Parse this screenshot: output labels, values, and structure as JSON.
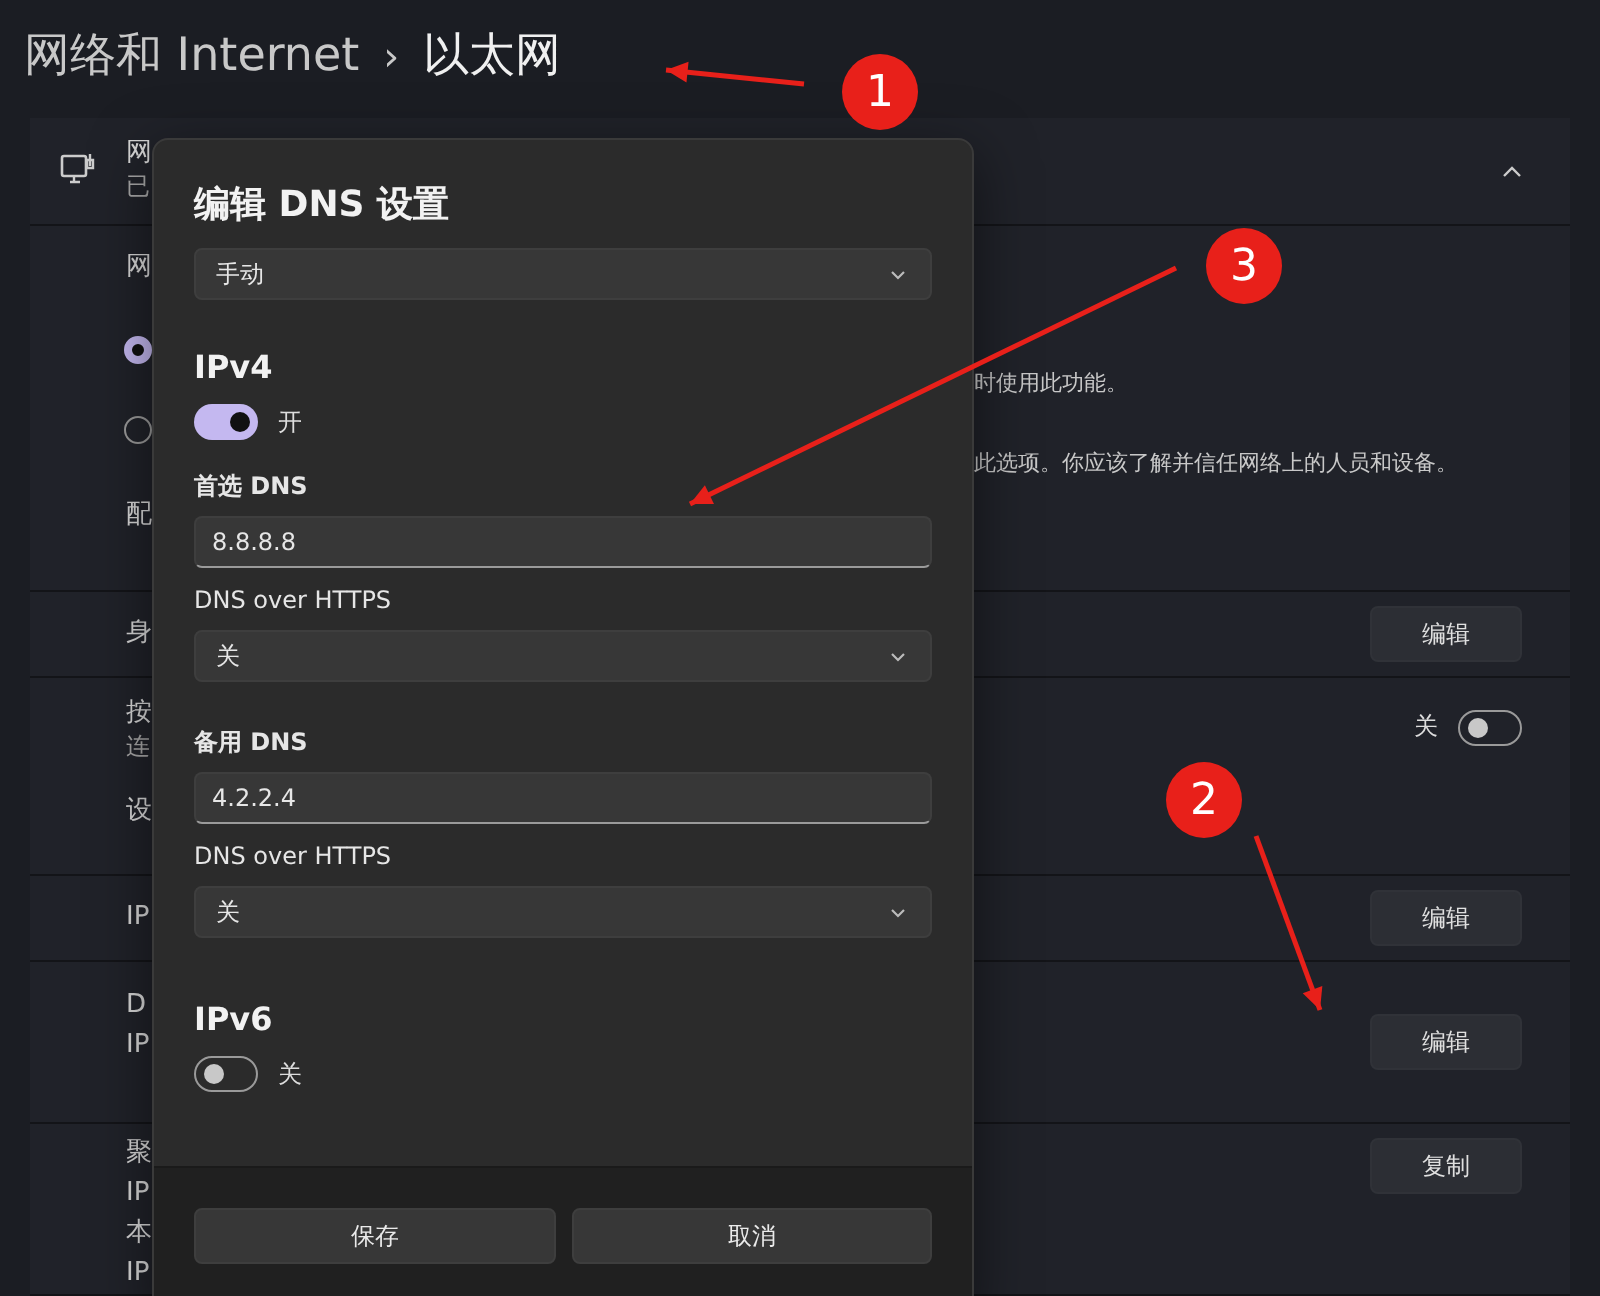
{
  "breadcrumb": {
    "parent": "网络和 Internet",
    "separator": "›",
    "current": "以太网"
  },
  "rows": [
    {
      "kind": "header",
      "fragments": [
        "网",
        "已"
      ],
      "expanded": true
    },
    {
      "kind": "options",
      "fragments": [
        "网"
      ],
      "options": [
        {
          "selected": true,
          "tail": "时使用此功能。"
        },
        {
          "selected": false,
          "tail": "此选项。你应该了解并信任网络上的人员和设备。"
        }
      ],
      "footer_fragment": "配"
    },
    {
      "kind": "button",
      "fragments": [
        "身"
      ],
      "button": "编辑"
    },
    {
      "kind": "toggle",
      "fragments": [
        "按",
        "连"
      ],
      "extra": "设",
      "toggle": {
        "label": "关",
        "on": false
      }
    },
    {
      "kind": "button",
      "fragments": [
        "IP"
      ],
      "button": "编辑"
    },
    {
      "kind": "button",
      "fragments": [
        "D",
        "IP"
      ],
      "button": "编辑"
    },
    {
      "kind": "button",
      "fragments": [
        "聚",
        "IP",
        "本",
        "IP"
      ],
      "button": "复制"
    }
  ],
  "dialog": {
    "title": "编辑 DNS 设置",
    "mode": "手动",
    "ipv4": {
      "heading": "IPv4",
      "on": true,
      "state": "开",
      "fields": [
        {
          "label": "首选 DNS",
          "value": "8.8.8.8",
          "doh_label": "DNS over HTTPS",
          "doh": "关"
        },
        {
          "label": "备用 DNS",
          "value": "4.2.2.4",
          "doh_label": "DNS over HTTPS",
          "doh": "关"
        }
      ]
    },
    "ipv6": {
      "heading": "IPv6",
      "on": false,
      "state": "关"
    },
    "buttons": [
      "保存",
      "取消"
    ]
  },
  "annotations": [
    {
      "label": "1"
    },
    {
      "label": "2"
    },
    {
      "label": "3"
    }
  ]
}
